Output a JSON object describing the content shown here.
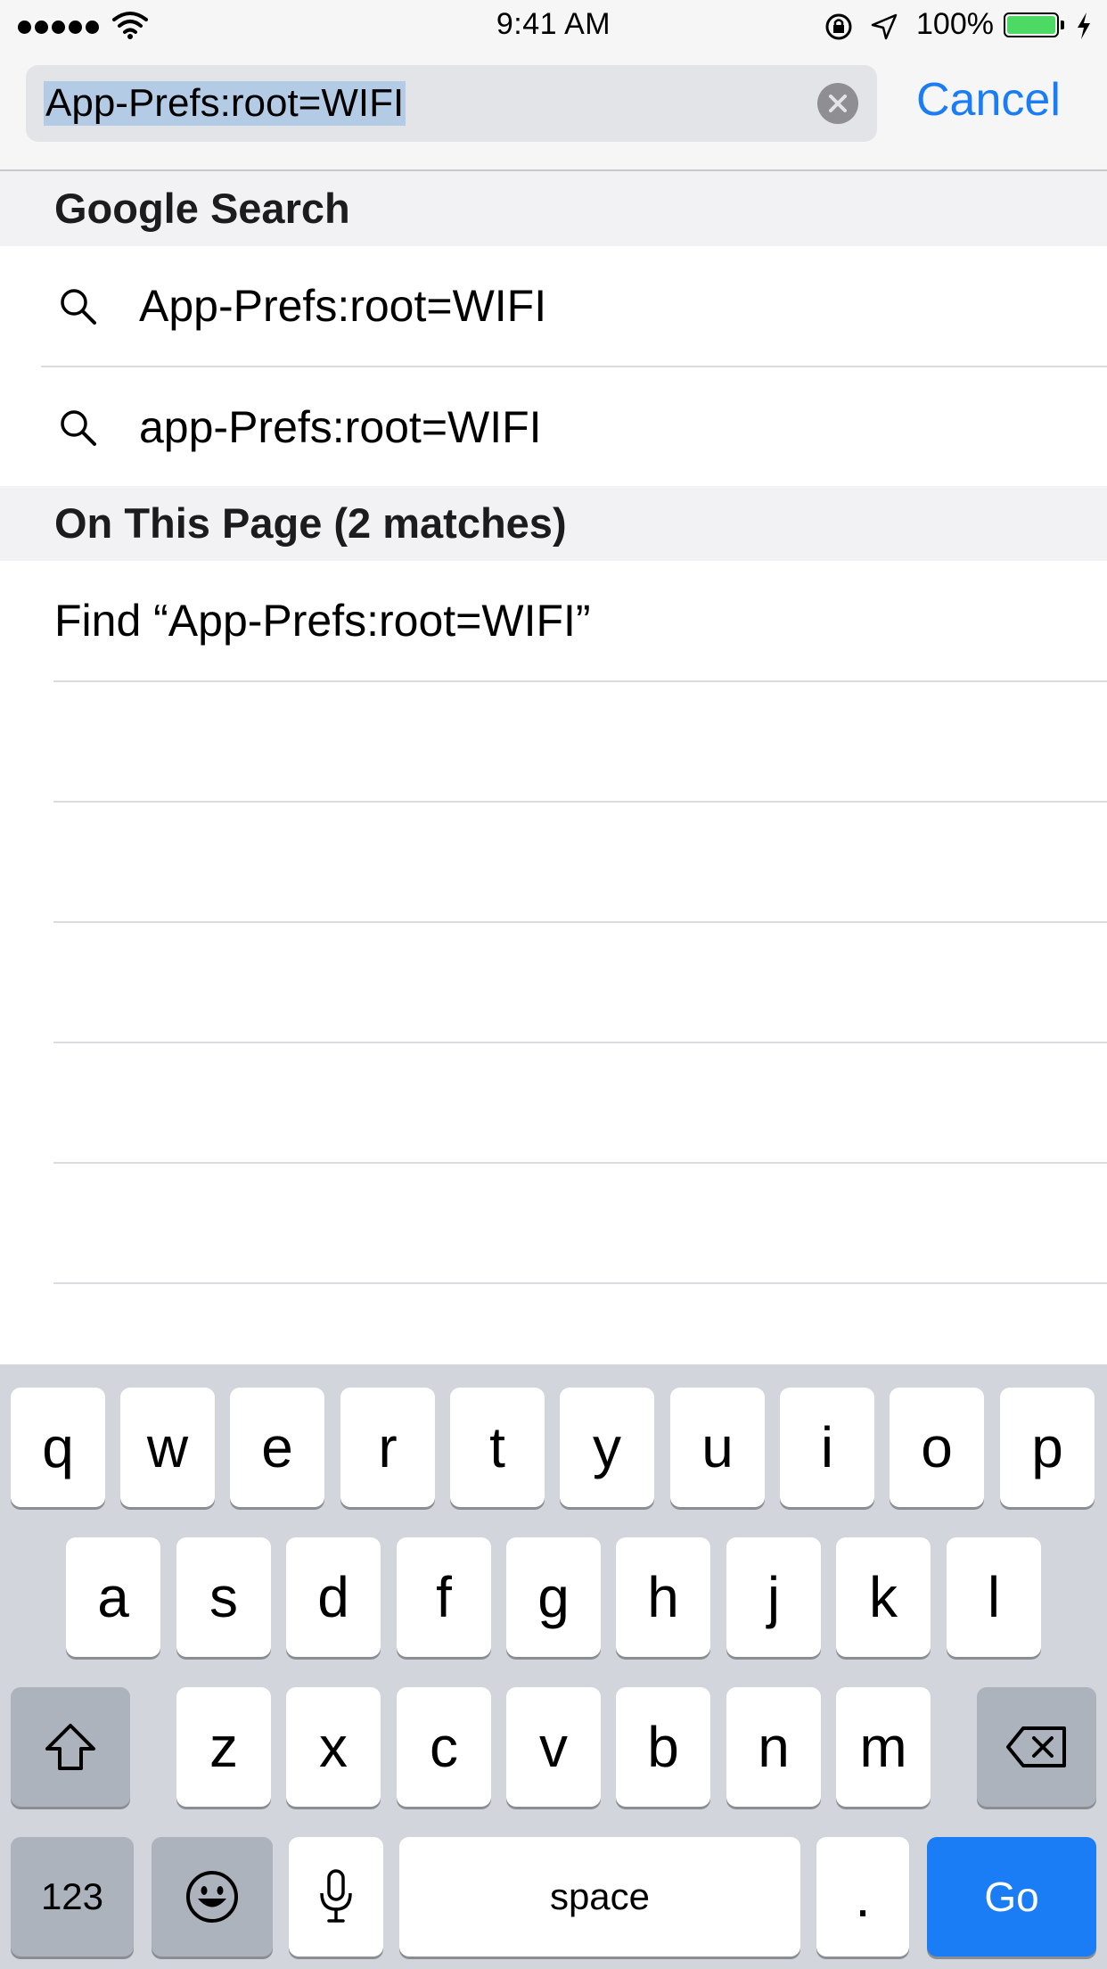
{
  "status_bar": {
    "time": "9:41 AM",
    "battery_percent": "100%",
    "signal_bars": 5,
    "battery_level": 1.0,
    "battery_color": "#4cd964"
  },
  "search_bar": {
    "query": "App-Prefs:root=WIFI",
    "cancel_label": "Cancel",
    "accent_color": "#1a7df5",
    "clear_icon": "clear-circle-icon"
  },
  "google_search": {
    "title": "Google Search",
    "suggestions": [
      "App-Prefs:root=WIFI",
      "app-Prefs:root=WIFI"
    ]
  },
  "on_this_page": {
    "title": "On This Page (2 matches)",
    "find_label": "Find “App-Prefs:root=WIFI”"
  },
  "keyboard": {
    "row1": [
      "q",
      "w",
      "e",
      "r",
      "t",
      "y",
      "u",
      "i",
      "o",
      "p"
    ],
    "row2": [
      "a",
      "s",
      "d",
      "f",
      "g",
      "h",
      "j",
      "k",
      "l"
    ],
    "row3": [
      "z",
      "x",
      "c",
      "v",
      "b",
      "n",
      "m"
    ],
    "numbers_label": "123",
    "space_label": "space",
    "period_label": ".",
    "go_label": "Go",
    "shift_icon": "shift-icon",
    "delete_icon": "delete-icon",
    "emoji_icon": "emoji-icon",
    "mic_icon": "microphone-icon"
  }
}
